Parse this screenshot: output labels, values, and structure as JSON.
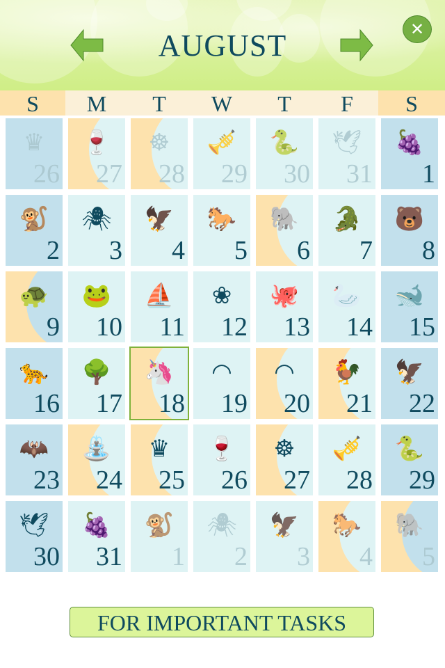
{
  "header": {
    "month": "AUGUST",
    "prev_icon": "arrow-left-icon",
    "next_icon": "arrow-right-icon",
    "close_icon": "close-icon",
    "close_glyph": "✕"
  },
  "colors": {
    "text": "#0f4a5e",
    "weekday_bg": "#fbf0d8",
    "weekend_header_bg": "#fde2ad",
    "cell_bg": "#def3f4",
    "weekend_cell_bg": "#c2e0ec",
    "moon": "#fde2ad",
    "today_border": "#7fb23a",
    "button_bg": "#dcf59a"
  },
  "weekdays": [
    "S",
    "M",
    "T",
    "W",
    "T",
    "F",
    "S"
  ],
  "weeks": [
    [
      {
        "day": "26",
        "icon": "crown-icon",
        "glyph": "♛",
        "other": true,
        "moon": false
      },
      {
        "day": "27",
        "icon": "goblet-icon",
        "glyph": "🍷",
        "other": true,
        "moon": true
      },
      {
        "day": "28",
        "icon": "wheel-icon",
        "glyph": "☸",
        "other": true,
        "moon": true
      },
      {
        "day": "29",
        "icon": "trumpet-icon",
        "glyph": "🎺",
        "other": true,
        "moon": false
      },
      {
        "day": "30",
        "icon": "snake-icon",
        "glyph": "🐍",
        "other": true,
        "moon": false
      },
      {
        "day": "31",
        "icon": "dove-icon",
        "glyph": "🕊",
        "other": true,
        "moon": false
      },
      {
        "day": "1",
        "icon": "grapes-icon",
        "glyph": "🍇",
        "other": false,
        "moon": false
      }
    ],
    [
      {
        "day": "2",
        "icon": "monkey-icon",
        "glyph": "🐒",
        "other": false,
        "moon": false
      },
      {
        "day": "3",
        "icon": "spider-icon",
        "glyph": "🕷",
        "other": false,
        "moon": false
      },
      {
        "day": "4",
        "icon": "eagle-icon",
        "glyph": "🦅",
        "other": false,
        "moon": false
      },
      {
        "day": "5",
        "icon": "horse-icon",
        "glyph": "🐎",
        "other": false,
        "moon": false
      },
      {
        "day": "6",
        "icon": "elephant-icon",
        "glyph": "🐘",
        "other": false,
        "moon": true
      },
      {
        "day": "7",
        "icon": "crocodile-icon",
        "glyph": "🐊",
        "other": false,
        "moon": false
      },
      {
        "day": "8",
        "icon": "bear-icon",
        "glyph": "🐻",
        "other": false,
        "moon": false
      }
    ],
    [
      {
        "day": "9",
        "icon": "turtle-icon",
        "glyph": "🐢",
        "other": false,
        "moon": true
      },
      {
        "day": "10",
        "icon": "frog-icon",
        "glyph": "🐸",
        "other": false,
        "moon": false
      },
      {
        "day": "11",
        "icon": "ship-icon",
        "glyph": "⛵",
        "other": false,
        "moon": false
      },
      {
        "day": "12",
        "icon": "lotus-icon",
        "glyph": "❀",
        "other": false,
        "moon": false
      },
      {
        "day": "13",
        "icon": "octopus-icon",
        "glyph": "🐙",
        "other": false,
        "moon": false
      },
      {
        "day": "14",
        "icon": "swan-lantern-icon",
        "glyph": "🦢",
        "other": false,
        "moon": false
      },
      {
        "day": "15",
        "icon": "whale-icon",
        "glyph": "🐋",
        "other": false,
        "moon": false
      }
    ],
    [
      {
        "day": "16",
        "icon": "cheetah-icon",
        "glyph": "🐆",
        "other": false,
        "moon": false
      },
      {
        "day": "17",
        "icon": "tree-icon",
        "glyph": "🌳",
        "other": false,
        "moon": false
      },
      {
        "day": "18",
        "icon": "unicorn-icon",
        "glyph": "🦄",
        "other": false,
        "moon": true,
        "today": true
      },
      {
        "day": "19",
        "icon": "rainbow-icon",
        "glyph": "◠",
        "other": false,
        "moon": false
      },
      {
        "day": "20",
        "icon": "rainbow-icon",
        "glyph": "◠",
        "other": false,
        "moon": true
      },
      {
        "day": "21",
        "icon": "rooster-icon",
        "glyph": "🐓",
        "other": false,
        "moon": true
      },
      {
        "day": "22",
        "icon": "phoenix-icon",
        "glyph": "🦅",
        "other": false,
        "moon": false
      }
    ],
    [
      {
        "day": "23",
        "icon": "bat-icon",
        "glyph": "🦇",
        "other": false,
        "moon": false
      },
      {
        "day": "24",
        "icon": "fountain-icon",
        "glyph": "⛲",
        "other": false,
        "moon": true
      },
      {
        "day": "25",
        "icon": "crown-icon",
        "glyph": "♛",
        "other": false,
        "moon": true
      },
      {
        "day": "26",
        "icon": "goblet-icon",
        "glyph": "🍷",
        "other": false,
        "moon": false
      },
      {
        "day": "27",
        "icon": "wheel-icon",
        "glyph": "☸",
        "other": false,
        "moon": true
      },
      {
        "day": "28",
        "icon": "trumpet-icon",
        "glyph": "🎺",
        "other": false,
        "moon": false
      },
      {
        "day": "29",
        "icon": "snake-icon",
        "glyph": "🐍",
        "other": false,
        "moon": false
      }
    ],
    [
      {
        "day": "30",
        "icon": "dove-icon",
        "glyph": "🕊",
        "other": false,
        "moon": false
      },
      {
        "day": "31",
        "icon": "grapes-icon",
        "glyph": "🍇",
        "other": false,
        "moon": false
      },
      {
        "day": "1",
        "icon": "monkey-icon",
        "glyph": "🐒",
        "other": true,
        "moon": false
      },
      {
        "day": "2",
        "icon": "spider-icon",
        "glyph": "🕷",
        "other": true,
        "moon": false
      },
      {
        "day": "3",
        "icon": "eagle-icon",
        "glyph": "🦅",
        "other": true,
        "moon": false
      },
      {
        "day": "4",
        "icon": "horse-icon",
        "glyph": "🐎",
        "other": true,
        "moon": true
      },
      {
        "day": "5",
        "icon": "elephant-icon",
        "glyph": "🐘",
        "other": true,
        "moon": true
      }
    ]
  ],
  "footer": {
    "button_label": "FOR IMPORTANT TASKS"
  }
}
